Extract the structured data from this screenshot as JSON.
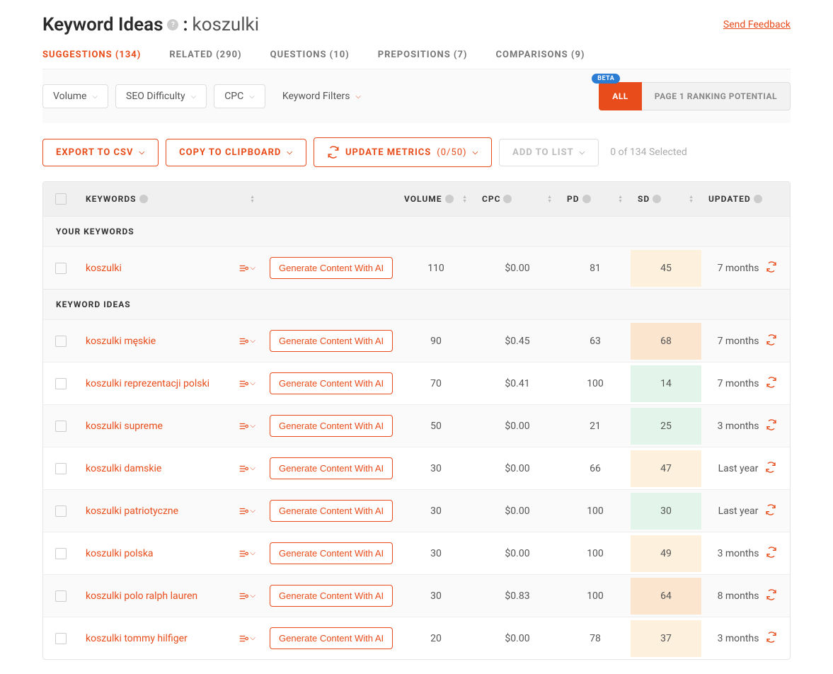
{
  "header": {
    "title_prefix": "Keyword Ideas",
    "keyword": "koszulki",
    "feedback": "Send Feedback"
  },
  "tabs": [
    {
      "label": "SUGGESTIONS (134)",
      "active": true
    },
    {
      "label": "RELATED (290)",
      "active": false
    },
    {
      "label": "QUESTIONS (10)",
      "active": false
    },
    {
      "label": "PREPOSITIONS (7)",
      "active": false
    },
    {
      "label": "COMPARISONS (9)",
      "active": false
    }
  ],
  "filters": {
    "volume": "Volume",
    "seo_difficulty": "SEO Difficulty",
    "cpc": "CPC",
    "keyword_filters": "Keyword Filters"
  },
  "toggle": {
    "beta": "BETA",
    "all": "ALL",
    "potential": "PAGE 1 RANKING POTENTIAL"
  },
  "actions": {
    "export": "EXPORT TO CSV",
    "copy": "COPY TO CLIPBOARD",
    "update_prefix": "UPDATE METRICS",
    "update_count": "(0/50)",
    "add_list": "ADD TO LIST",
    "selected": "0 of 134 Selected"
  },
  "columns": {
    "keywords": "KEYWORDS",
    "volume": "VOLUME",
    "cpc": "CPC",
    "pd": "PD",
    "sd": "SD",
    "updated": "UPDATED"
  },
  "sections": {
    "your": "YOUR KEYWORDS",
    "ideas": "KEYWORD IDEAS"
  },
  "gen_label": "Generate Content With AI",
  "your_keywords": [
    {
      "kw": "koszulki",
      "volume": "110",
      "cpc": "$0.00",
      "pd": "81",
      "sd": "45",
      "sd_class": "sd-yellow",
      "updated": "7 months"
    }
  ],
  "ideas": [
    {
      "kw": "koszulki męskie",
      "volume": "90",
      "cpc": "$0.45",
      "pd": "63",
      "sd": "68",
      "sd_class": "sd-orange",
      "updated": "7 months"
    },
    {
      "kw": "koszulki reprezentacji polski",
      "volume": "70",
      "cpc": "$0.41",
      "pd": "100",
      "sd": "14",
      "sd_class": "sd-green",
      "updated": "7 months"
    },
    {
      "kw": "koszulki supreme",
      "volume": "50",
      "cpc": "$0.00",
      "pd": "21",
      "sd": "25",
      "sd_class": "sd-green",
      "updated": "3 months"
    },
    {
      "kw": "koszulki damskie",
      "volume": "30",
      "cpc": "$0.00",
      "pd": "66",
      "sd": "47",
      "sd_class": "sd-yellow",
      "updated": "Last year"
    },
    {
      "kw": "koszulki patriotyczne",
      "volume": "30",
      "cpc": "$0.00",
      "pd": "100",
      "sd": "30",
      "sd_class": "sd-green",
      "updated": "Last year"
    },
    {
      "kw": "koszulki polska",
      "volume": "30",
      "cpc": "$0.00",
      "pd": "100",
      "sd": "49",
      "sd_class": "sd-yellow",
      "updated": "3 months"
    },
    {
      "kw": "koszulki polo ralph lauren",
      "volume": "30",
      "cpc": "$0.83",
      "pd": "100",
      "sd": "64",
      "sd_class": "sd-orange",
      "updated": "8 months"
    },
    {
      "kw": "koszulki tommy hilfiger",
      "volume": "20",
      "cpc": "$0.00",
      "pd": "78",
      "sd": "37",
      "sd_class": "sd-yellow",
      "updated": "3 months"
    }
  ]
}
